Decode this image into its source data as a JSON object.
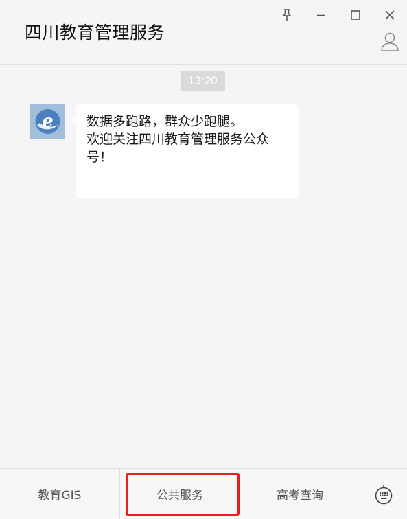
{
  "window": {
    "title": "四川教育管理服务",
    "controls": {
      "pin_icon": "pin-icon",
      "minimize_icon": "minimize-icon",
      "maximize_icon": "maximize-icon",
      "close_icon": "close-icon",
      "profile_icon": "person-icon"
    }
  },
  "chat": {
    "timestamp": "13:20",
    "messages": [
      {
        "sender_avatar": "edu-e-logo",
        "lines": [
          "数据多跑路，群众少跑腿。",
          "欢迎关注四川教育管理服务公众",
          "号！"
        ]
      }
    ]
  },
  "menu": {
    "items": [
      {
        "label": "教育GIS"
      },
      {
        "label": "公共服务"
      },
      {
        "label": "高考查询"
      }
    ],
    "keyboard_icon": "keyboard-icon",
    "highlighted_item": "公共服务",
    "highlight_color": "#e62020"
  }
}
